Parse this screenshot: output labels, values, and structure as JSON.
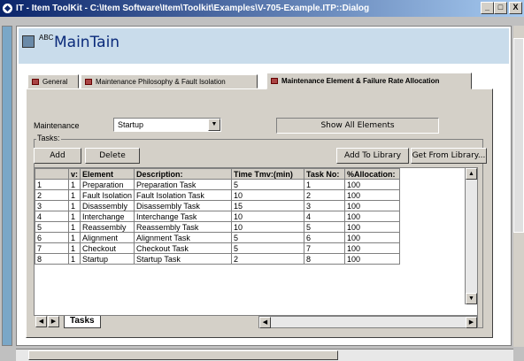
{
  "window": {
    "title": "IT - Item ToolKit - C:\\Item Software\\Item\\Toolkit\\Examples\\V-705-Example.ITP::Dialog",
    "min_label": "_",
    "max_label": "□",
    "close_label": "X"
  },
  "header": {
    "abc_label": "ABC",
    "title": "MainTain"
  },
  "tabs": [
    {
      "label": "General"
    },
    {
      "label": "Maintenance Philosophy & Fault Isolation"
    },
    {
      "label": "Maintenance Element & Failure Rate Allocation"
    }
  ],
  "form": {
    "maintenance_label": "Maintenance",
    "maintenance_value": "Startup",
    "show_all_label": "Show All Elements",
    "tasks_group_label": "Tasks:",
    "add_label": "Add",
    "delete_label": "Delete",
    "add_to_library_label": "Add To Library",
    "get_from_library_label": "Get From Library..."
  },
  "grid": {
    "columns": [
      "",
      "v:",
      "Element",
      "Description:",
      "Time Tmv:(min)",
      "Task No:",
      "%Allocation:"
    ],
    "rows": [
      [
        "1",
        "1",
        "Preparation",
        "Preparation Task",
        "5",
        "1",
        "100"
      ],
      [
        "2",
        "1",
        "Fault Isolation",
        "Fault Isolation Task",
        "10",
        "2",
        "100"
      ],
      [
        "3",
        "1",
        "Disassembly",
        "Disassembly Task",
        "15",
        "3",
        "100"
      ],
      [
        "4",
        "1",
        "Interchange",
        "Interchange Task",
        "10",
        "4",
        "100"
      ],
      [
        "5",
        "1",
        "Reassembly",
        "Reassembly Task",
        "10",
        "5",
        "100"
      ],
      [
        "6",
        "1",
        "Alignment",
        "Alignment Task",
        "5",
        "6",
        "100"
      ],
      [
        "7",
        "1",
        "Checkout",
        "Checkout Task",
        "5",
        "7",
        "100"
      ],
      [
        "8",
        "1",
        "Startup",
        "Startup Task",
        "2",
        "8",
        "100"
      ]
    ],
    "sheet_tab": "Tasks"
  },
  "colors": {
    "title_gradient_start": "#0a246a",
    "header_band": "#c9dceb",
    "header_title": "#0a2a7a",
    "face": "#d4d0c8"
  }
}
